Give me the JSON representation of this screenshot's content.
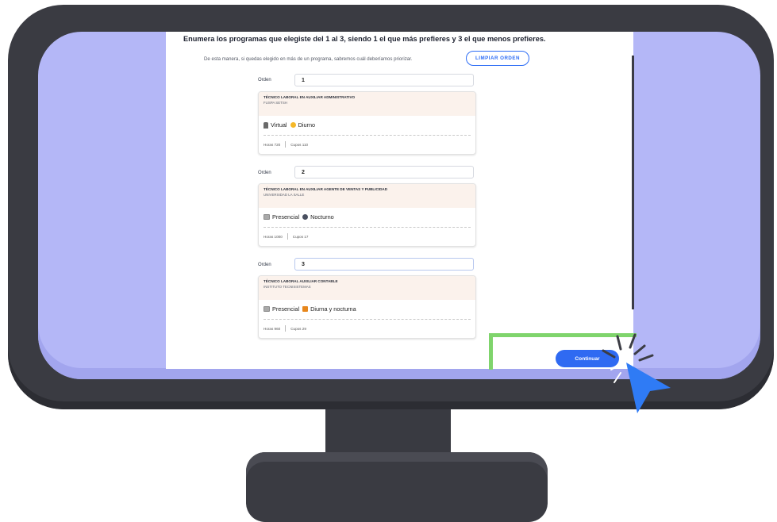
{
  "page": {
    "title": "Enumera los programas que elegiste del 1 al 3, siendo 1 el que más prefieres y 3 el que menos prefieres.",
    "subtitle": "De esta manera, si quedas elegido en más de un programa, sabremos cuál deberíamos priorizar.",
    "clear_button": "LIMPIAR ORDEN",
    "continue_button": "Continuar",
    "order_label": "Orden"
  },
  "programs": [
    {
      "order": "1",
      "name": "TÉCNICO LABORAL EN AUXILIAR ADMINISTRATIVO",
      "institution": "FUSPA SETSH",
      "modality": "Virtual",
      "modality_icon": "virtual-icon",
      "schedule": "Diurno",
      "schedule_icon": "sun-icon",
      "hours": "Horas 720",
      "slots": "Cupos 110"
    },
    {
      "order": "2",
      "name": "TÉCNICO LABORAL EN AUXILIAR AGENTE DE VENTAS Y PUBLICIDAD",
      "institution": "UNIVERSIDAD LA SALLE",
      "modality": "Presencial",
      "modality_icon": "building-icon",
      "schedule": "Nocturno",
      "schedule_icon": "moon-icon",
      "hours": "Horas 1000",
      "slots": "Cupos 17"
    },
    {
      "order": "3",
      "name": "TÉCNICO LABORAL AUXILIAR CONTABLE",
      "institution": "INSTITUTO TECNISISTEMAS",
      "modality": "Presencial",
      "modality_icon": "building-icon",
      "schedule": "Diurna y nocturna",
      "schedule_icon": "sun-moon-icon",
      "hours": "Horas 960",
      "slots": "Cupos 29"
    }
  ],
  "colors": {
    "accent": "#2f6af2",
    "highlight": "#7fd46c",
    "monitor": "#3a3b42",
    "screen": "#b4b7f7"
  }
}
